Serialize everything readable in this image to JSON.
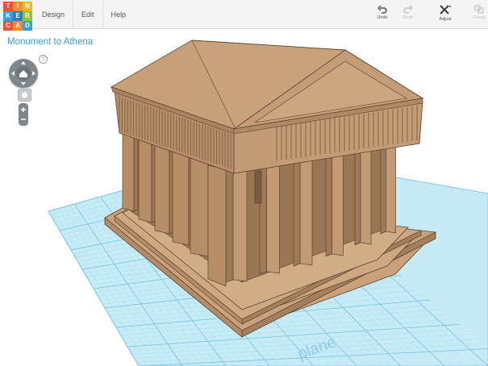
{
  "app": {
    "logo_letters": [
      "T",
      "I",
      "N",
      "K",
      "E",
      "R",
      "C",
      "A",
      "D"
    ],
    "logo_colors": [
      "#e8513a",
      "#f28c28",
      "#f2b81c",
      "#3aa0d2",
      "#2d7fb8",
      "#8dc63f",
      "#e8513a",
      "#f28c28",
      "#3aa0d2"
    ]
  },
  "menu": {
    "design": "Design",
    "edit": "Edit",
    "help": "Help"
  },
  "toolbar": {
    "undo": "Undo",
    "redo": "Redo",
    "adjust": "Adjust",
    "group": "Group"
  },
  "design": {
    "title": "Monument to Athena"
  },
  "viewport": {
    "help": "?",
    "workplane_label": "plane"
  },
  "colors": {
    "accent": "#3aa0d2",
    "grid": "#b8e3f2",
    "model": "#c9a27c"
  }
}
